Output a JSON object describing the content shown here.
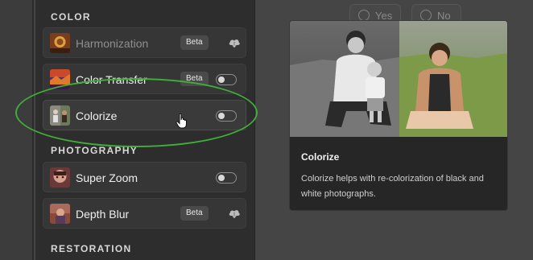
{
  "sections": {
    "color": "COLOR",
    "photography": "PHOTOGRAPHY",
    "restoration": "RESTORATION"
  },
  "filters": [
    {
      "name": "Harmonization",
      "badge": "Beta",
      "control": "cloud-download-icon",
      "enabled": false
    },
    {
      "name": "Color Transfer",
      "badge": "Beta",
      "control": "toggle",
      "toggle_on": false
    },
    {
      "name": "Colorize",
      "control": "toggle",
      "toggle_on": false,
      "selected": true
    },
    {
      "name": "Super Zoom",
      "control": "toggle",
      "toggle_on": false
    },
    {
      "name": "Depth Blur",
      "badge": "Beta",
      "control": "cloud-download-icon"
    }
  ],
  "feedback": {
    "yes_label": "Yes",
    "no_label": "No"
  },
  "preview": {
    "title": "Colorize",
    "description": "Colorize helps with re-colorization of black and white photographs."
  },
  "colors": {
    "highlight": "#3fae3a",
    "panel": "#2d2d2d",
    "background": "#454545"
  }
}
